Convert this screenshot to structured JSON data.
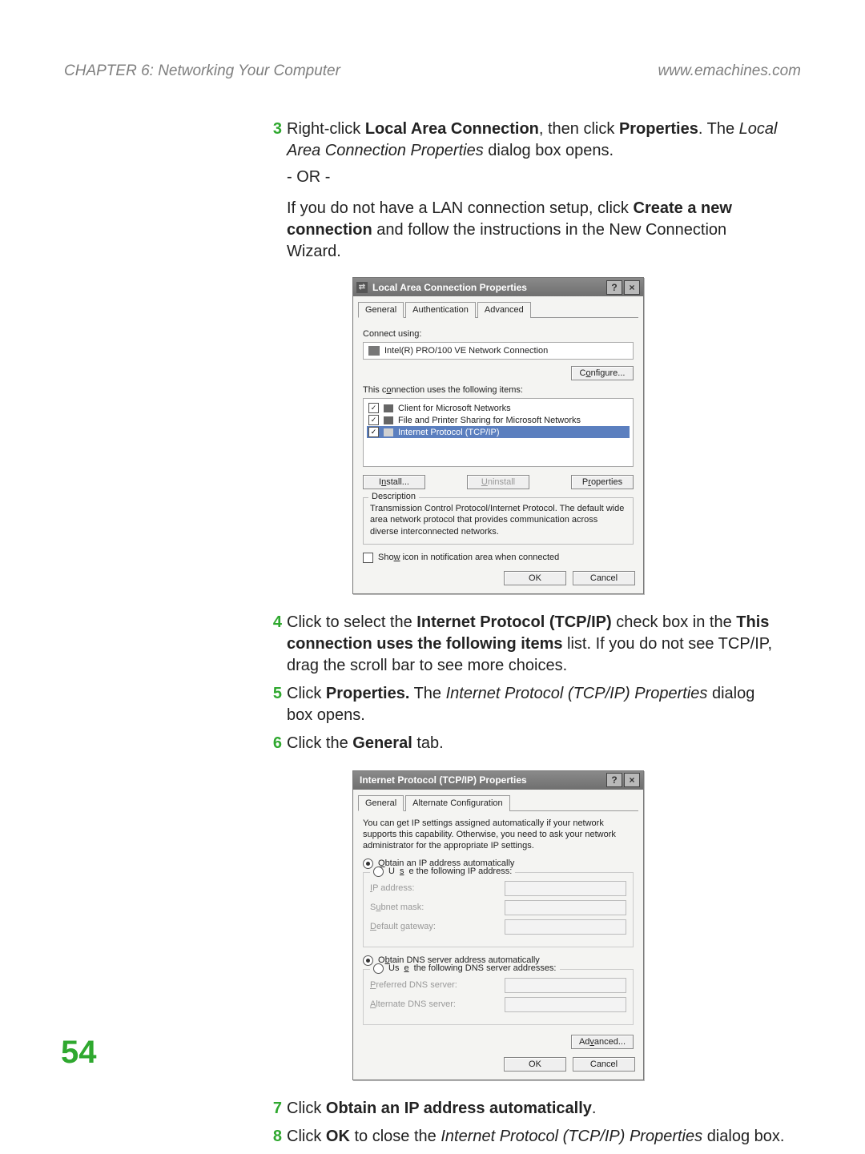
{
  "header": {
    "chapter": "CHAPTER 6: Networking Your Computer",
    "url": "www.emachines.com"
  },
  "page_number": "54",
  "common": {
    "ok": "OK",
    "cancel": "Cancel"
  },
  "steps": {
    "s3": {
      "num": "3",
      "t1": "Right-click",
      "b1": "Local Area Connection",
      "t2": ", then click",
      "b2": "Properties",
      "t3": ". The",
      "i1": "Local Area Connection Properties",
      "t4": "dialog box opens."
    },
    "or": "- OR -",
    "alt": {
      "t1": "If you do not have a LAN connection setup, click",
      "b1": "Create a new connection",
      "t2": "and follow the instructions in the New Connection Wizard."
    },
    "s4": {
      "num": "4",
      "t1": "Click to select the",
      "b1": "Internet Protocol (TCP/IP)",
      "t2": "check box in the",
      "b2": "This connection uses the following items",
      "t3": "list. If you do not see TCP/IP, drag the scroll bar to see more choices."
    },
    "s5": {
      "num": "5",
      "t1": "Click",
      "b1": "Properties.",
      "t2": "The",
      "i1": "Internet Protocol (TCP/IP) Properties",
      "t3": "dialog box opens."
    },
    "s6": {
      "num": "6",
      "t1": "Click the",
      "b1": "General",
      "t2": "tab."
    },
    "s7": {
      "num": "7",
      "t1": "Click",
      "b1": "Obtain an IP address automatically",
      "t2": "."
    },
    "s8": {
      "num": "8",
      "t1": "Click",
      "b1": "OK",
      "t2": "to close the",
      "i1": "Internet Protocol (TCP/IP) Properties",
      "t3": "dialog box."
    }
  },
  "dlg1": {
    "title": "Local Area Connection Properties",
    "tabs": [
      "General",
      "Authentication",
      "Advanced"
    ],
    "connect_using_label": "Connect using:",
    "adapter": "Intel(R) PRO/100 VE Network Connection",
    "configure_pre": "C",
    "configure_u": "o",
    "configure_post": "nfigure...",
    "items_pre": "This c",
    "items_u": "o",
    "items_post": "nnection uses the following items:",
    "items": [
      "Client for Microsoft Networks",
      "File and Printer Sharing for Microsoft Networks",
      "Internet Protocol (TCP/IP)"
    ],
    "install_pre": "I",
    "install_u": "n",
    "install_post": "stall...",
    "uninstall_u": "U",
    "uninstall_post": "ninstall",
    "properties_pre": "P",
    "properties_u": "r",
    "properties_post": "operties",
    "desc_legend": "Description",
    "desc": "Transmission Control Protocol/Internet Protocol. The default wide area network protocol that provides communication across diverse interconnected networks.",
    "show_pre": "Sho",
    "show_u": "w",
    "show_post": " icon in notification area when connected"
  },
  "dlg2": {
    "title": "Internet Protocol (TCP/IP) Properties",
    "tabs": [
      "General",
      "Alternate Configuration"
    ],
    "intro": "You can get IP settings assigned automatically if your network supports this capability. Otherwise, you need to ask your network administrator for the appropriate IP settings.",
    "auto_ip_u": "O",
    "auto_ip_post": "btain an IP address automatically",
    "use_ip_pre": "U",
    "use_ip_u": "s",
    "use_ip_post": "e the following IP address:",
    "ip_u": "I",
    "ip_post": "P address:",
    "subnet_pre": "S",
    "subnet_u": "u",
    "subnet_post": "bnet mask:",
    "gw_u": "D",
    "gw_post": "efault gateway:",
    "auto_dns_pre": "O",
    "auto_dns_u": "b",
    "auto_dns_post": "tain DNS server address automatically",
    "use_dns_pre": "Us",
    "use_dns_u": "e",
    "use_dns_post": " the following DNS server addresses:",
    "pdns_u": "P",
    "pdns_post": "referred DNS server:",
    "adns_u": "A",
    "adns_post": "lternate DNS server:",
    "adv_pre": "Ad",
    "adv_u": "v",
    "adv_post": "anced..."
  }
}
